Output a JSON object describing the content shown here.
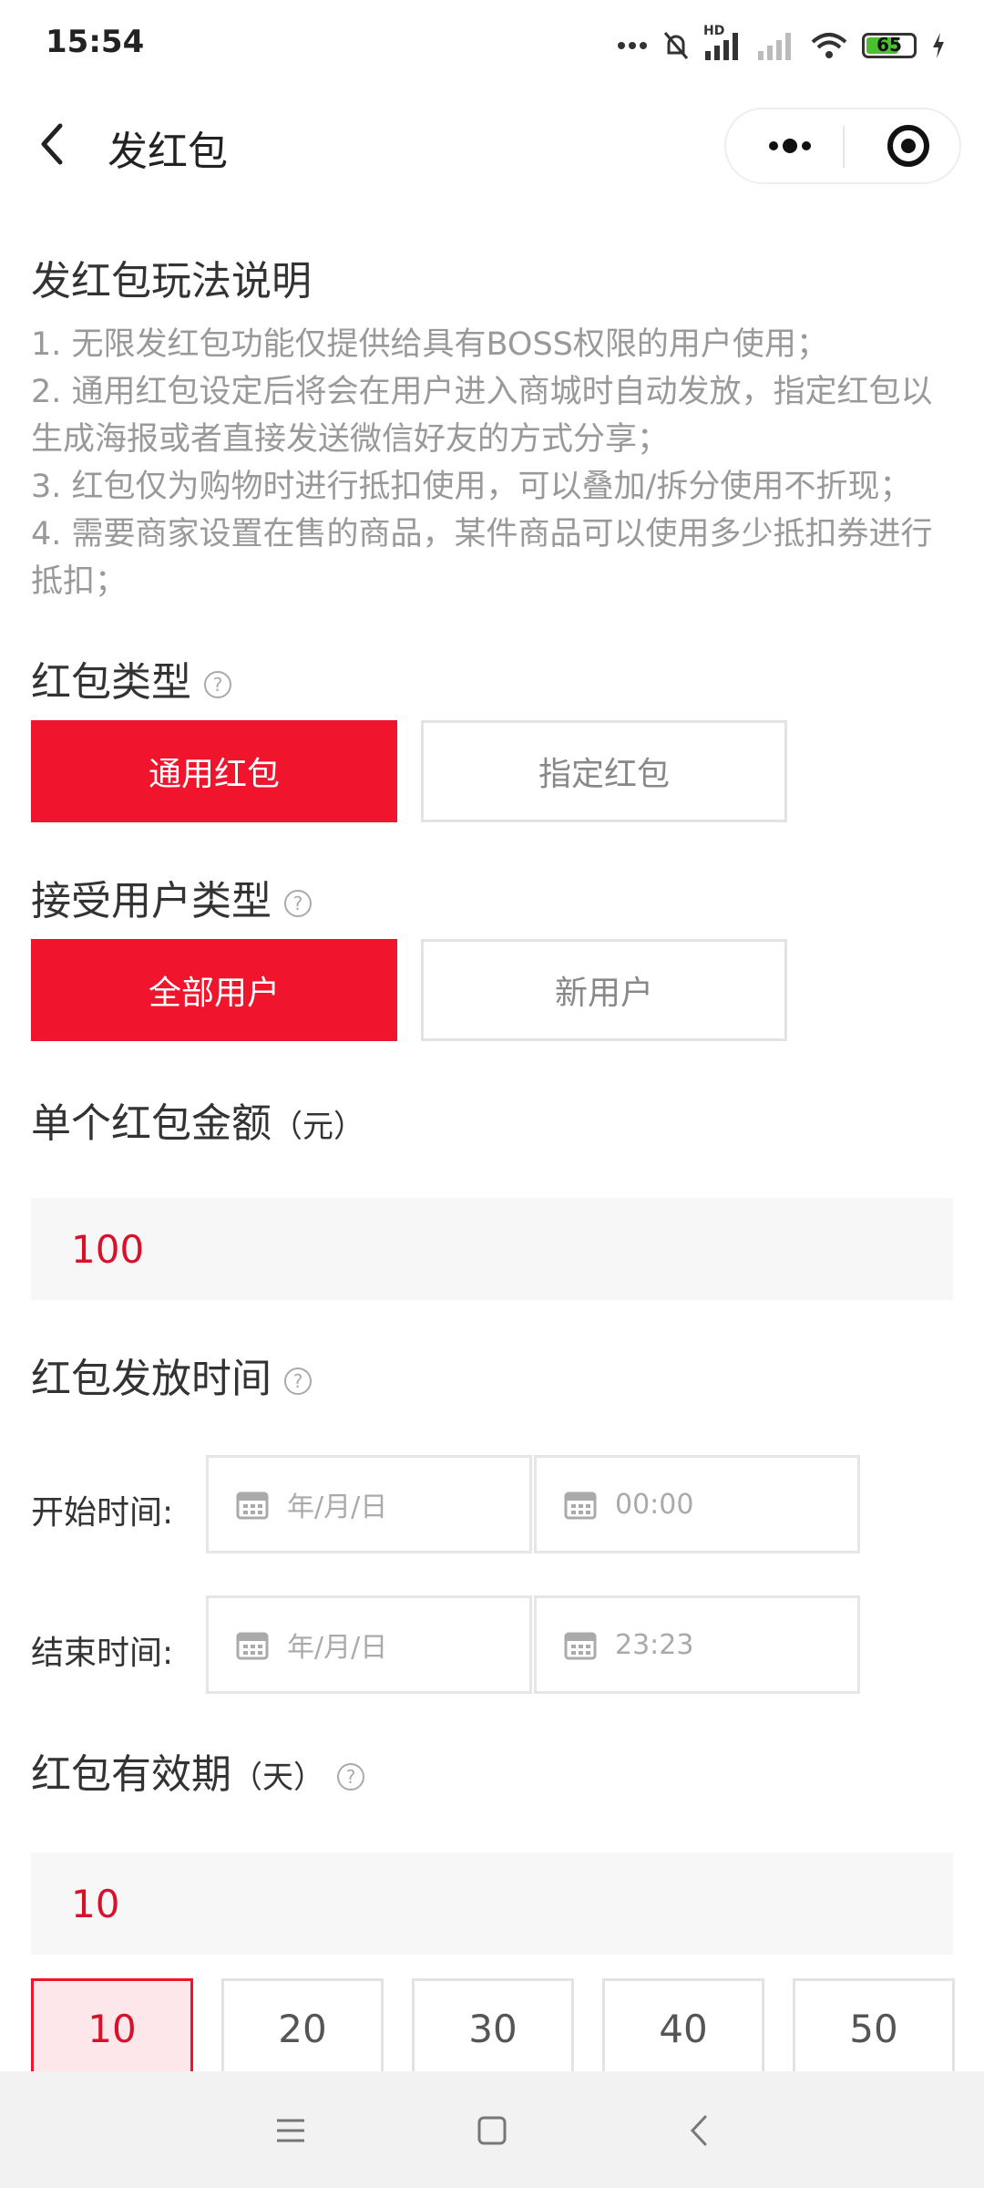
{
  "status_bar": {
    "time": "15:54",
    "battery": "65",
    "hd": "HD"
  },
  "nav": {
    "title": "发红包"
  },
  "rules": {
    "title": "发红包玩法说明",
    "lines": [
      "1. 无限发红包功能仅提供给具有BOSS权限的用户使用；",
      "2. 通用红包设定后将会在用户进入商城时自动发放，指定红包以生成海报或者直接发送微信好友的方式分享；",
      "3. 红包仅为购物时进行抵扣使用，可以叠加/拆分使用不折现；",
      "4. 需要商家设置在售的商品，某件商品可以使用多少抵扣券进行抵扣；"
    ]
  },
  "redpacket_type": {
    "title": "红包类型",
    "options": [
      "通用红包",
      "指定红包"
    ],
    "selected": "通用红包"
  },
  "user_type": {
    "title": "接受用户类型",
    "options": [
      "全部用户",
      "新用户"
    ],
    "selected": "全部用户"
  },
  "amount": {
    "title": "单个红包金额",
    "unit": "（元）",
    "value": "100"
  },
  "send_time": {
    "title": "红包发放时间",
    "start_label": "开始时间:",
    "start_date_placeholder": "年/月/日",
    "start_time": "00:00",
    "end_label": "结束时间:",
    "end_date_placeholder": "年/月/日",
    "end_time": "23:23"
  },
  "validity": {
    "title": "红包有效期",
    "unit": "（天）",
    "value": "10",
    "options": [
      "10",
      "20",
      "30",
      "40",
      "50"
    ],
    "selected": "10"
  },
  "help_glyph": "?",
  "colors": {
    "accent": "#f0142d",
    "value_text": "#d8102a",
    "muted": "#999999"
  }
}
